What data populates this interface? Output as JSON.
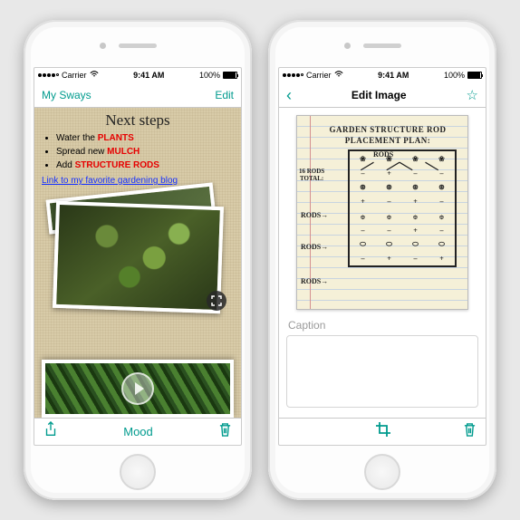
{
  "status": {
    "carrier": "Carrier",
    "wifi_icon": "wifi",
    "time": "9:41 AM",
    "battery_pct": "100%"
  },
  "phone1": {
    "nav": {
      "back_label": "My Sways",
      "edit_label": "Edit"
    },
    "note": {
      "title": "Next steps",
      "bullets": [
        {
          "text": "Water the ",
          "emph": "PLANTS"
        },
        {
          "text": "Spread new ",
          "emph": "MULCH"
        },
        {
          "text": "Add ",
          "emph": "STRUCTURE RODS"
        }
      ],
      "link_text": "Link to my favorite gardening blog"
    },
    "toolbar": {
      "share_icon": "share",
      "center_label": "Mood",
      "trash_icon": "trash"
    },
    "icons": {
      "expand": "expand-icon",
      "play": "play-icon"
    }
  },
  "phone2": {
    "nav": {
      "back_icon": "chevron-left",
      "title": "Edit Image",
      "star_icon": "star"
    },
    "handwriting": {
      "line1": "GARDEN STRUCTURE ROD",
      "line2": "PLACEMENT PLAN:",
      "rods_label": "RODS",
      "total_label_1": "16 RODS",
      "total_label_2": "TOTAL:",
      "side_labels": [
        "RODS→",
        "RODS→",
        "RODS→"
      ]
    },
    "caption_label": "Caption",
    "caption_value": "",
    "toolbar": {
      "crop_icon": "crop",
      "trash_icon": "trash"
    }
  }
}
